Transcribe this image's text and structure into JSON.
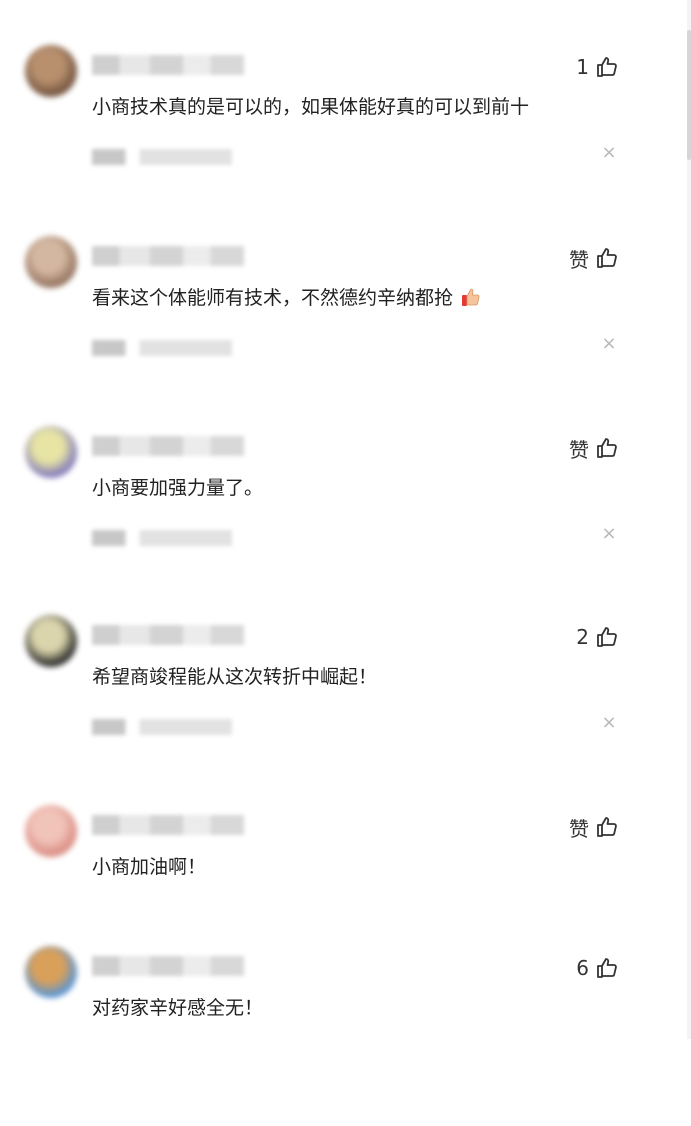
{
  "comments": [
    {
      "like_label": "1",
      "text": "小商技术真的是可以的，如果体能好真的可以到前十",
      "has_emoji": false,
      "avatar_colors": [
        "#6b4a35",
        "#b58b67"
      ]
    },
    {
      "like_label": "赞",
      "text": "看来这个体能师有技术，不然德约辛纳都抢",
      "has_emoji": true,
      "avatar_colors": [
        "#8d6a55",
        "#d2b49c"
      ]
    },
    {
      "like_label": "赞",
      "text": "小商要加强力量了。",
      "has_emoji": false,
      "avatar_colors": [
        "#7a71b8",
        "#e6e3a0"
      ]
    },
    {
      "like_label": "2",
      "text": "希望商竣程能从这次转折中崛起！",
      "has_emoji": false,
      "avatar_colors": [
        "#1c1c1c",
        "#d9d3a8"
      ]
    },
    {
      "like_label": "赞",
      "text": "小商加油啊！",
      "has_emoji": false,
      "avatar_colors": [
        "#d7857b",
        "#f1c1b6"
      ]
    },
    {
      "like_label": "6",
      "text": "对药家辛好感全无！",
      "has_emoji": false,
      "avatar_colors": [
        "#4f8fd2",
        "#d89b52"
      ]
    }
  ],
  "icons": {
    "like": "thumbs-up-icon",
    "close": "close-icon",
    "emoji": "thumbs-up-emoji-icon"
  }
}
